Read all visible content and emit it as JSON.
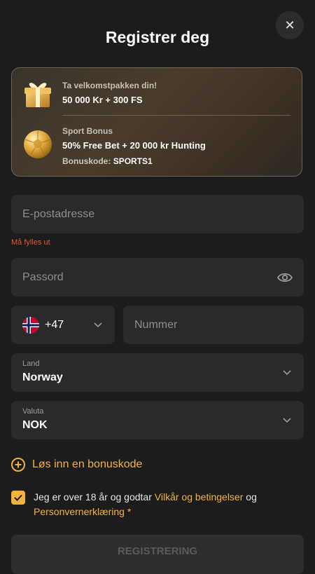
{
  "header": {
    "title": "Registrer deg",
    "close_icon": "close-icon"
  },
  "promo": {
    "welcome": {
      "label": "Ta velkomstpakken din!",
      "offer": "50 000 Kr + 300 FS",
      "icon": "gift-icon"
    },
    "sport": {
      "label": "Sport Bonus",
      "offer": "50% Free Bet + 20 000 kr Hunting",
      "code_label": "Bonuskode:",
      "code_value": "SPORTS1",
      "icon": "soccer-ball-icon"
    }
  },
  "form": {
    "email": {
      "placeholder": "E-postadresse",
      "value": "",
      "error": "Må fylles ut"
    },
    "password": {
      "placeholder": "Passord",
      "value": "",
      "icon": "eye-icon"
    },
    "phone": {
      "country_code": "+47",
      "flag": "norway-flag-icon",
      "placeholder": "Nummer",
      "value": ""
    },
    "country": {
      "label": "Land",
      "value": "Norway"
    },
    "currency": {
      "label": "Valuta",
      "value": "NOK"
    }
  },
  "bonus_code": {
    "label": "Løs inn en bonuskode"
  },
  "terms": {
    "checked": true,
    "text_before": "Jeg er over 18 år og godtar ",
    "terms_link": "Vilkår og betingelser",
    "text_middle": " og ",
    "privacy_link": "Personvernerklæring",
    "required_mark": "*"
  },
  "submit": {
    "label": "REGISTRERING"
  },
  "colors": {
    "accent": "#f2b33d",
    "error": "#e4572e",
    "background": "#1c1c1c",
    "field": "#2a2a2a"
  }
}
